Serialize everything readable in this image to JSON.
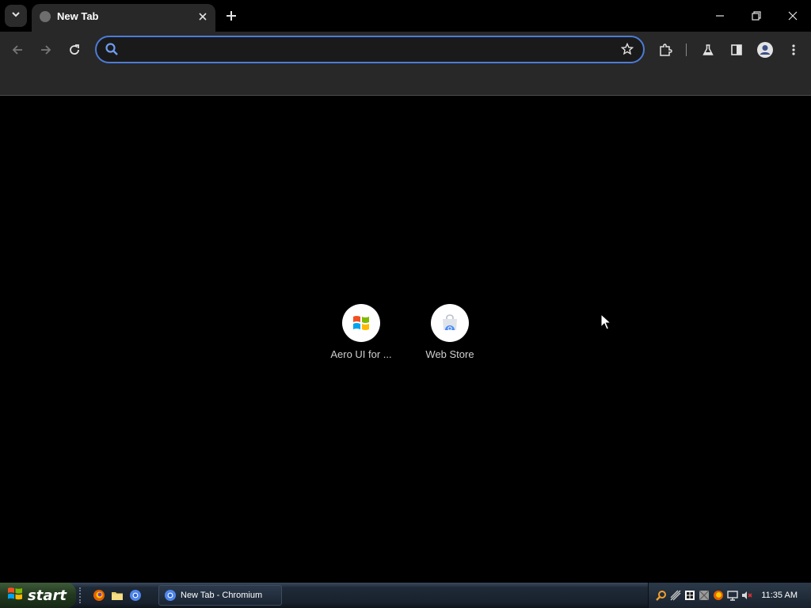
{
  "window": {
    "tab_title": "New Tab"
  },
  "toolbar": {
    "omnibox_placeholder": ""
  },
  "new_tab_page": {
    "shortcuts": [
      {
        "title": "Aero UI for ...",
        "icon": "windows-flag-icon"
      },
      {
        "title": "Web Store",
        "icon": "web-store-icon"
      }
    ]
  },
  "taskbar": {
    "start_label": "start",
    "task_button_label": "New Tab - Chromium",
    "quick_launch": [
      "firefox-icon",
      "folder-icon",
      "chromium-icon"
    ],
    "tray_icons": [
      "search-icon",
      "network-icon",
      "security-shield-icon",
      "display-icon",
      "firefox-icon",
      "monitor-icon",
      "volume-muted-icon"
    ],
    "clock": "11:35 AM"
  },
  "colors": {
    "page_background": "#000000",
    "toolbar": "#282828",
    "omnibox_focus_ring": "#4c7cd8",
    "tab_active": "#282828"
  }
}
